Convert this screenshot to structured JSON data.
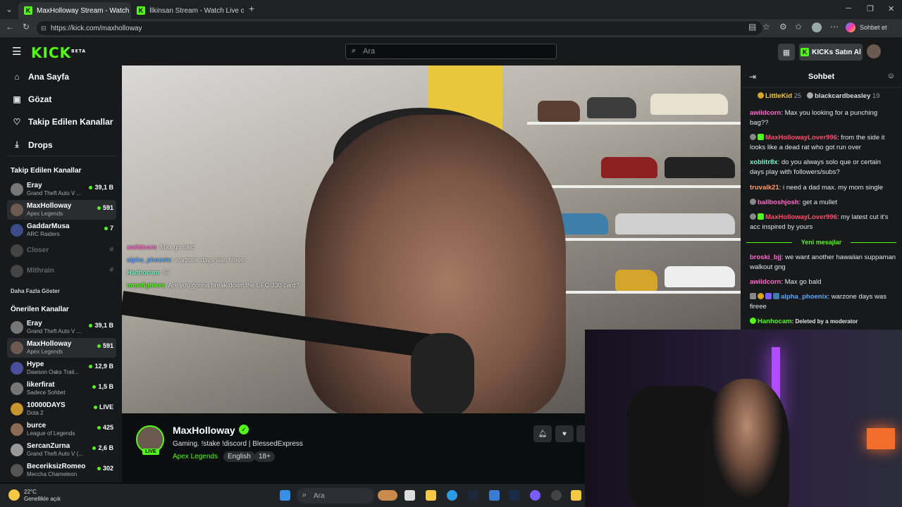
{
  "browser": {
    "tabs": [
      {
        "title": "MaxHolloway Stream - Watch Live",
        "active": true
      },
      {
        "title": "İlkinsan Stream - Watch Live on Ki",
        "active": false
      }
    ],
    "new_tab": "+",
    "url": "https://kick.com/maxholloway",
    "copilot_label": "Sohbet et",
    "close_glyph": "✕"
  },
  "header": {
    "logo": "KICK",
    "logo_sup": "BETA",
    "search_placeholder": "Ara",
    "buy_kicks": "KICKs Satın Al"
  },
  "nav": {
    "home": "Ana Sayfa",
    "browse": "Gözat",
    "following": "Takip Edilen Kanallar",
    "drops": "Drops"
  },
  "sidebar": {
    "followed_title": "Takip Edilen Kanallar",
    "followed": [
      {
        "name": "Eray",
        "game": "Grand Theft Auto V ...",
        "viewers": "39,1 B"
      },
      {
        "name": "MaxHolloway",
        "game": "Apex Legends",
        "viewers": "591"
      },
      {
        "name": "GaddarMusa",
        "game": "ARC Raiders",
        "viewers": "7"
      },
      {
        "name": "Closer",
        "game": "",
        "viewers": ""
      },
      {
        "name": "Mithrain",
        "game": "",
        "viewers": ""
      }
    ],
    "show_more": "Daha Fazla Göster",
    "recommended_title": "Önerilen Kanallar",
    "recommended": [
      {
        "name": "Eray",
        "game": "Grand Theft Auto V ...",
        "viewers": "39,1 B"
      },
      {
        "name": "MaxHolloway",
        "game": "Apex Legends",
        "viewers": "591"
      },
      {
        "name": "Hype",
        "game": "Dawson Oaks Trail...",
        "viewers": "12,9 B"
      },
      {
        "name": "likerfirat",
        "game": "Sadece Sohbet",
        "viewers": "1,5 B"
      },
      {
        "name": "10000DAYS",
        "game": "Dota 2",
        "viewers": "LIVE"
      },
      {
        "name": "burce",
        "game": "League of Legends",
        "viewers": "425"
      },
      {
        "name": "SercanZurna",
        "game": "Grand Theft Auto V (...",
        "viewers": "2,6 B"
      },
      {
        "name": "BeceriksizRomeo",
        "game": "Meccha Chameleon",
        "viewers": "302"
      }
    ]
  },
  "video_overlay_chat": [
    {
      "user": "awildcorn",
      "text": ": Max go bald"
    },
    {
      "user": "alpha_phoenix",
      "text": ": warzone days was fireee"
    },
    {
      "user": "Hanhocam",
      "text": ": Sil"
    },
    {
      "user": "mmafighters",
      "text": ": Are you gonna break down the UFC 330 card?"
    }
  ],
  "channel": {
    "name": "MaxHolloway",
    "live": "LIVE",
    "title": "Gaming. !stake !discord | BlessedExpress",
    "category": "Apex Legends",
    "tags": [
      "English",
      "18+"
    ]
  },
  "chat": {
    "title": "Sohbet",
    "gifters": [
      {
        "name": "LittleKid",
        "count": "25"
      },
      {
        "name": "blackcardbeasley",
        "count": "19"
      }
    ],
    "messages_before": [
      {
        "user": "awildcorn",
        "color": "#ff6bcb",
        "text": ": Max you looking for a punching bag??"
      },
      {
        "user": "MaxHollowayLover996",
        "color": "#ff4d6d",
        "text": ": from the side it looks like a dead rat who got run over"
      },
      {
        "user": "xoblitr8x",
        "color": "#7cf5c8",
        "text": ": do you always solo que or certain days play with followers/subs?"
      },
      {
        "user": "truvalk21",
        "color": "#ff9f6b",
        "text": ": i need a dad max. my mom single"
      },
      {
        "user": "ballboshjosh",
        "color": "#ff6bcb",
        "text": ": get a mullet"
      },
      {
        "user": "MaxHollowayLover996",
        "color": "#ff4d6d",
        "text": ": my latest cut it's acc inspired by yours"
      }
    ],
    "new_messages": "Yeni mesajlar",
    "messages_after": [
      {
        "user": "broski_bjj",
        "color": "#ff6bcb",
        "text": ": we want another hawaiian suppaman walkout gng"
      },
      {
        "user": "awildcorn",
        "color": "#ff6bcb",
        "text": ": Max go bald"
      },
      {
        "user": "alpha_phoenix",
        "color": "#5aa9ff",
        "text": ": warzone days was fireee"
      },
      {
        "user": "Hanhocam",
        "color": "#53fc18",
        "text": ": Deleted by a moderator"
      }
    ]
  },
  "taskbar": {
    "temp": "22°C",
    "weather": "Genellikle açık",
    "search": "Ara"
  },
  "colors": {
    "accent": "#53fc18",
    "bg": "#0b0e0f",
    "panel": "#18191b"
  }
}
